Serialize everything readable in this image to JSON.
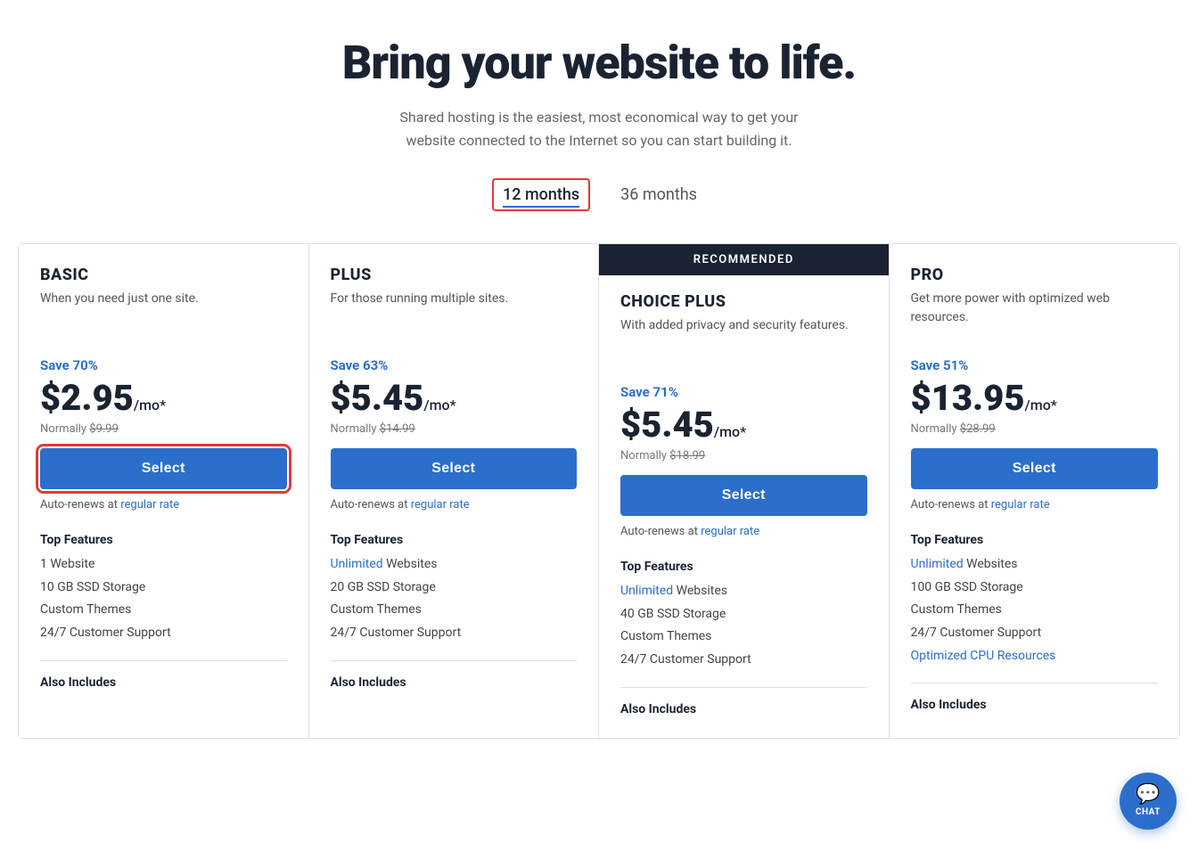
{
  "hero": {
    "title": "Bring your website to life.",
    "subtitle_line1": "Shared hosting is the easiest, most economical way to get your",
    "subtitle_line2": "website connected to the Internet so you can start building it."
  },
  "billing": {
    "options": [
      {
        "id": "12months",
        "label": "12 months",
        "active": true
      },
      {
        "id": "36months",
        "label": "36 months",
        "active": false
      }
    ]
  },
  "recommended_label": "RECOMMENDED",
  "plans": [
    {
      "id": "basic",
      "name": "BASIC",
      "desc": "When you need just one site.",
      "save": "Save 70%",
      "price": "$2.95",
      "per": "/mo*",
      "normal": "Normally $9.99",
      "normal_price": "$9.99",
      "select_label": "Select",
      "highlighted": true,
      "recommended": false,
      "auto_renew": "Auto-renews at",
      "auto_renew_link": "regular rate",
      "features_title": "Top Features",
      "features": [
        {
          "text": "1 Website",
          "link": false
        },
        {
          "text": "10 GB SSD Storage",
          "link": false
        },
        {
          "text": "Custom Themes",
          "link": false
        },
        {
          "text": "24/7 Customer Support",
          "link": false
        }
      ],
      "also_includes": "Also Includes"
    },
    {
      "id": "plus",
      "name": "PLUS",
      "desc": "For those running multiple sites.",
      "save": "Save 63%",
      "price": "$5.45",
      "per": "/mo*",
      "normal": "Normally $14.99",
      "normal_price": "$14.99",
      "select_label": "Select",
      "highlighted": false,
      "recommended": false,
      "auto_renew": "Auto-renews at",
      "auto_renew_link": "regular rate",
      "features_title": "Top Features",
      "features": [
        {
          "text": "Unlimited",
          "link": true,
          "suffix": " Websites"
        },
        {
          "text": "20 GB SSD Storage",
          "link": false
        },
        {
          "text": "Custom Themes",
          "link": false
        },
        {
          "text": "24/7 Customer Support",
          "link": false
        }
      ],
      "also_includes": "Also Includes"
    },
    {
      "id": "choice-plus",
      "name": "CHOICE PLUS",
      "desc": "With added privacy and security features.",
      "save": "Save 71%",
      "price": "$5.45",
      "per": "/mo*",
      "normal": "Normally $18.99",
      "normal_price": "$18.99",
      "select_label": "Select",
      "highlighted": false,
      "recommended": true,
      "auto_renew": "Auto-renews at",
      "auto_renew_link": "regular rate",
      "features_title": "Top Features",
      "features": [
        {
          "text": "Unlimited",
          "link": true,
          "suffix": " Websites"
        },
        {
          "text": "40 GB SSD Storage",
          "link": false
        },
        {
          "text": "Custom Themes",
          "link": false
        },
        {
          "text": "24/7 Customer Support",
          "link": false
        }
      ],
      "also_includes": "Also Includes"
    },
    {
      "id": "pro",
      "name": "PRO",
      "desc": "Get more power with optimized web resources.",
      "save": "Save 51%",
      "price": "$13.95",
      "per": "/mo*",
      "normal": "Normally $28.99",
      "normal_price": "$28.99",
      "select_label": "Select",
      "highlighted": false,
      "recommended": false,
      "auto_renew": "Auto-renews at",
      "auto_renew_link": "regular rate",
      "features_title": "Top Features",
      "features": [
        {
          "text": "Unlimited",
          "link": true,
          "suffix": " Websites"
        },
        {
          "text": "100 GB SSD Storage",
          "link": false
        },
        {
          "text": "Custom Themes",
          "link": false
        },
        {
          "text": "24/7 Customer Support",
          "link": false
        },
        {
          "text": "Optimized CPU Resources",
          "link": true
        }
      ],
      "also_includes": "Also Includes"
    }
  ],
  "chat": {
    "label": "CHAT",
    "icon": "💬"
  }
}
